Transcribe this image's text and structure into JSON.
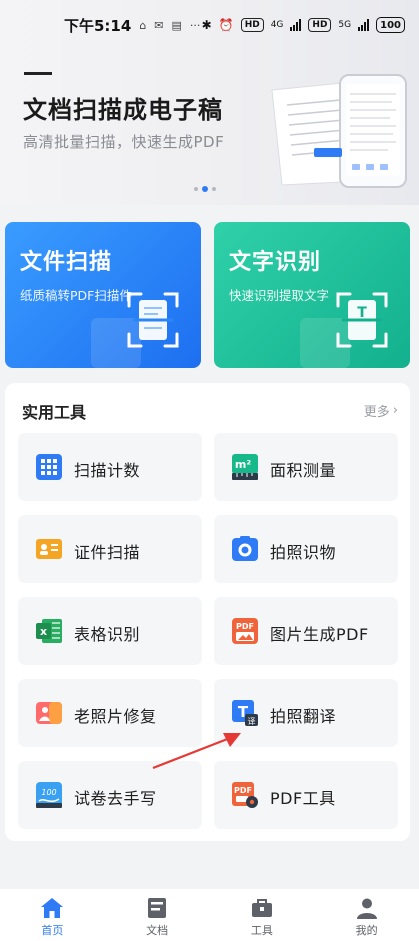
{
  "status_bar": {
    "time": "下午5:14",
    "extra": "···",
    "net1": "4G",
    "net2": "5G",
    "battery": "100"
  },
  "banner": {
    "title": "文档扫描成电子稿",
    "subtitle": "高清批量扫描，快速生成PDF",
    "active_dot": 1
  },
  "cards": [
    {
      "title": "文件扫描",
      "subtitle": "纸质稿转PDF扫描件",
      "color": "#2a86f8"
    },
    {
      "title": "文字识别",
      "subtitle": "快速识别提取文字",
      "color": "#1fc29c"
    }
  ],
  "tools_panel": {
    "heading": "实用工具",
    "more_label": "更多",
    "items": [
      {
        "label": "扫描计数",
        "icon": "scan-count-icon"
      },
      {
        "label": "面积测量",
        "icon": "area-measure-icon"
      },
      {
        "label": "证件扫描",
        "icon": "id-card-scan-icon"
      },
      {
        "label": "拍照识物",
        "icon": "camera-object-icon"
      },
      {
        "label": "表格识别",
        "icon": "excel-table-icon"
      },
      {
        "label": "图片生成PDF",
        "icon": "image-to-pdf-icon"
      },
      {
        "label": "老照片修复",
        "icon": "photo-restore-icon"
      },
      {
        "label": "拍照翻译",
        "icon": "photo-translate-icon"
      },
      {
        "label": "试卷去手写",
        "icon": "remove-handwriting-icon"
      },
      {
        "label": "PDF工具",
        "icon": "pdf-tools-icon"
      }
    ]
  },
  "bottom_nav": [
    {
      "label": "首页",
      "icon": "home-icon",
      "active": true
    },
    {
      "label": "文档",
      "icon": "document-icon",
      "active": false
    },
    {
      "label": "工具",
      "icon": "toolbox-icon",
      "active": false
    },
    {
      "label": "我的",
      "icon": "profile-icon",
      "active": false
    }
  ],
  "colors": {
    "accent": "#2f7bf6",
    "annotation_arrow": "#e53935"
  }
}
